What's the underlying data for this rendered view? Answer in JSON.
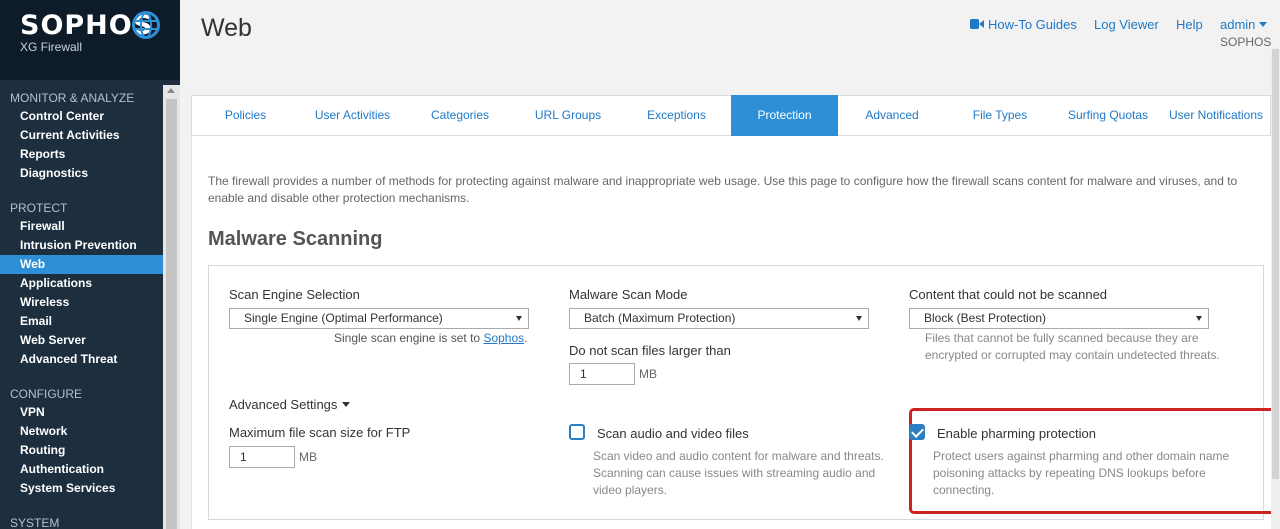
{
  "brand": {
    "name": "SOPHOS",
    "product": "XG Firewall"
  },
  "sidebar": {
    "sections": [
      {
        "heading": "MONITOR & ANALYZE",
        "items": [
          "Control Center",
          "Current Activities",
          "Reports",
          "Diagnostics"
        ]
      },
      {
        "heading": "PROTECT",
        "items": [
          "Firewall",
          "Intrusion Prevention",
          "Web",
          "Applications",
          "Wireless",
          "Email",
          "Web Server",
          "Advanced Threat"
        ]
      },
      {
        "heading": "CONFIGURE",
        "items": [
          "VPN",
          "Network",
          "Routing",
          "Authentication",
          "System Services"
        ]
      },
      {
        "heading": "SYSTEM",
        "items": []
      }
    ],
    "active_item": "Web"
  },
  "header": {
    "title": "Web",
    "links": {
      "howto": "How-To Guides",
      "log_viewer": "Log Viewer",
      "help": "Help",
      "user": "admin"
    },
    "company": "SOPHOS"
  },
  "tabs": [
    "Policies",
    "User Activities",
    "Categories",
    "URL Groups",
    "Exceptions",
    "Protection",
    "Advanced",
    "File Types",
    "Surfing Quotas",
    "User Notifications"
  ],
  "active_tab": "Protection",
  "intro": "The firewall provides a number of methods for protecting against malware and inappropriate web usage. Use this page to configure how the firewall scans content for malware and viruses, and to enable and disable other protection mechanisms.",
  "malware": {
    "title": "Malware Scanning",
    "engine_label": "Scan Engine Selection",
    "engine_value": "Single Engine (Optimal Performance)",
    "engine_hint_prefix": "Single scan engine is set to ",
    "engine_hint_link": "Sophos",
    "engine_hint_suffix": ".",
    "mode_label": "Malware Scan Mode",
    "mode_value": "Batch (Maximum Protection)",
    "max_size_label": "Do not scan files larger than",
    "max_size_value": "1",
    "max_size_unit": "MB",
    "unscannable_label": "Content that could not be scanned",
    "unscannable_value": "Block (Best Protection)",
    "unscannable_hint": "Files that cannot be fully scanned because they are encrypted or corrupted may contain undetected threats.",
    "advanced_label": "Advanced Settings",
    "ftp_label": "Maximum file scan size for FTP",
    "ftp_value": "1",
    "ftp_unit": "MB",
    "av_label": "Scan audio and video files",
    "av_checked": false,
    "av_hint": "Scan video and audio content for malware and threats. Scanning can cause issues with streaming audio and video players.",
    "pharming_label": "Enable pharming protection",
    "pharming_checked": true,
    "pharming_hint": "Protect users against pharming and other domain name poisoning attacks by repeating DNS lookups before connecting."
  },
  "colors": {
    "sidebar": "#1d2e3f",
    "accent": "#2d8fd5",
    "link": "#1f79c7",
    "highlight": "#cc2222"
  }
}
